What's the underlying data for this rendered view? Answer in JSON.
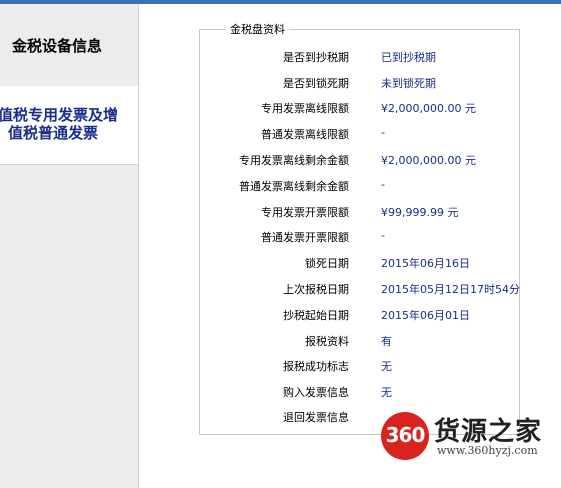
{
  "sidebar": {
    "tab1": "金税设备信息",
    "tab2_line1": "值税专用发票及增",
    "tab2_line2": "值税普通发票"
  },
  "panel": {
    "legend": "金税盘资料",
    "rows": [
      {
        "label": "是否到抄税期",
        "value": "已到抄税期"
      },
      {
        "label": "是否到锁死期",
        "value": "未到锁死期"
      },
      {
        "label": "专用发票离线限额",
        "value": "¥2,000,000.00 元"
      },
      {
        "label": "普通发票离线限额",
        "value": "-"
      },
      {
        "label": "专用发票离线剩余金额",
        "value": "¥2,000,000.00 元"
      },
      {
        "label": "普通发票离线剩余金额",
        "value": "-"
      },
      {
        "label": "专用发票开票限额",
        "value": "¥99,999.99 元"
      },
      {
        "label": "普通发票开票限额",
        "value": "-"
      },
      {
        "label": "锁死日期",
        "value": "2015年06月16日"
      },
      {
        "label": "上次报税日期",
        "value": "2015年05月12日17时54分"
      },
      {
        "label": "抄税起始日期",
        "value": "2015年06月01日"
      },
      {
        "label": "报税资料",
        "value": "有"
      },
      {
        "label": "报税成功标志",
        "value": "无"
      },
      {
        "label": "购入发票信息",
        "value": "无"
      },
      {
        "label": "退回发票信息",
        "value": ""
      }
    ]
  },
  "watermark": {
    "number": "360",
    "name": "货源之家",
    "url": "www.360hyzj.com"
  }
}
